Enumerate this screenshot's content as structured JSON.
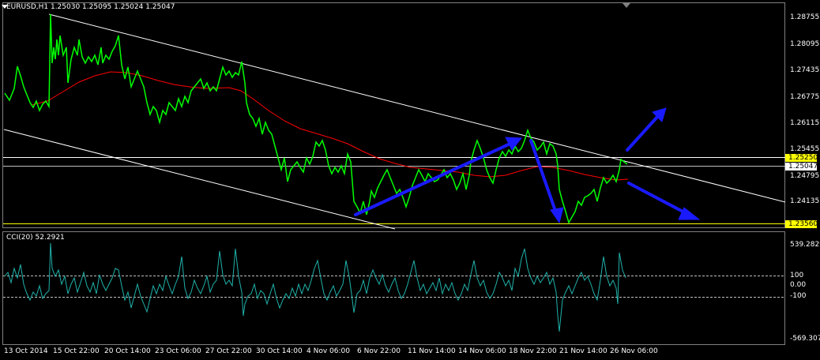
{
  "header": {
    "symbol_line": "EURUSD,H1  1.25030 1.25095 1.25024 1.25047"
  },
  "indicator": {
    "header": "CCI(20) 52.2921",
    "levels": [
      "539.2829",
      "100",
      "0.00",
      "-100",
      "-569.3071"
    ]
  },
  "price_axis": {
    "ticks": [
      "1.28755",
      "1.28095",
      "1.27435",
      "1.26775",
      "1.26115",
      "1.25455",
      "1.24795",
      "1.24135"
    ],
    "high_line_label": "1.25250",
    "current_price_label": "1.25047",
    "low_line_label": "1.23560"
  },
  "time_axis": {
    "ticks": [
      "13 Oct 2014",
      "15 Oct 22:00",
      "20 Oct 14:00",
      "23 Oct 06:00",
      "27 Oct 22:00",
      "30 Oct 14:00",
      "4 Nov 06:00",
      "6 Nov 22:00",
      "11 Nov 14:00",
      "14 Nov 06:00",
      "18 Nov 22:00",
      "21 Nov 14:00",
      "26 Nov 06:00"
    ]
  },
  "colors": {
    "background": "#000000",
    "price_line": "#00ff00",
    "moving_average": "#ff0000",
    "indicator_line": "#20b2aa",
    "channel_lines": "#ffffff",
    "arrows": "#1a1aff",
    "level_box": "#ffff00"
  },
  "chart_data": {
    "type": "line",
    "title": "EURUSD,H1",
    "series": [
      {
        "name": "EURUSD",
        "values": [
          1.27,
          1.28,
          1.265,
          1.2875,
          1.276,
          1.283,
          1.277,
          1.272,
          1.269,
          1.273,
          1.277,
          1.263,
          1.256,
          1.25,
          1.249,
          1.2525,
          1.237,
          1.242,
          1.248,
          1.2495,
          1.246,
          1.2515,
          1.256,
          1.254,
          1.2575,
          1.256,
          1.24,
          1.242,
          1.247,
          1.2505
        ]
      }
    ],
    "ylim": [
      1.2356,
      1.29
    ]
  }
}
